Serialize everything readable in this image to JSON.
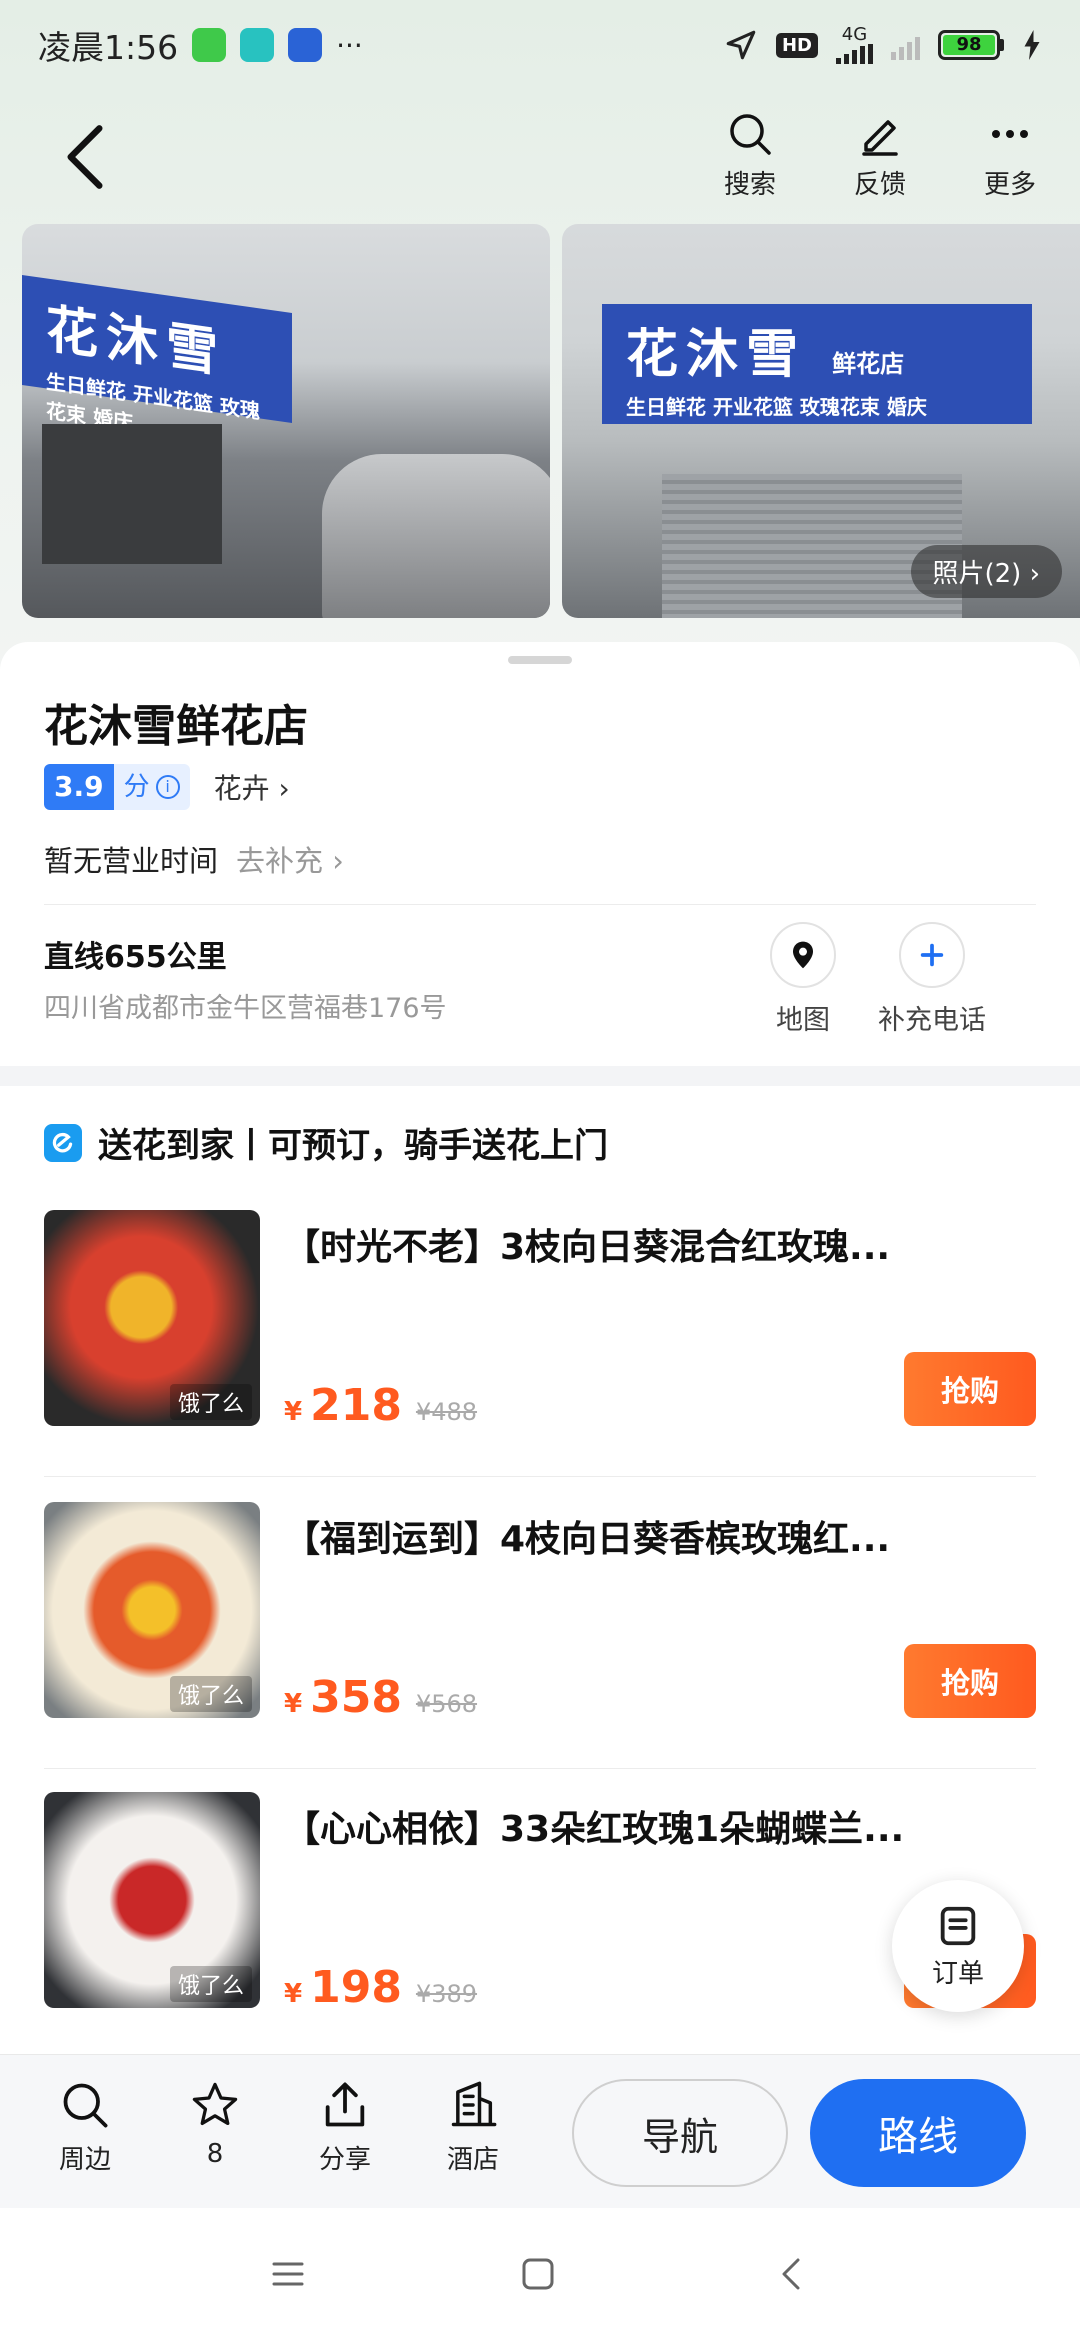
{
  "status_bar": {
    "time": "凌晨1:56",
    "more": "···",
    "hd": "HD",
    "network": "4G",
    "battery": "98"
  },
  "header": {
    "actions": [
      {
        "label": "搜索",
        "icon": "search-icon"
      },
      {
        "label": "反馈",
        "icon": "pencil-icon"
      },
      {
        "label": "更多",
        "icon": "more-icon"
      }
    ]
  },
  "photos": {
    "sign_text": "花沐雪",
    "sign_sub": "鲜花店",
    "sign_tagline_1": "生日鲜花 开业花篮 玫瑰花束 婚庆",
    "count_label": "照片(2) ›"
  },
  "poi": {
    "name": "花沐雪鲜花店",
    "rating": "3.9",
    "rating_unit": "分",
    "category": "花卉 ›",
    "hours": "暂无营业时间",
    "hours_link": "去补充 ›",
    "distance": "直线655公里",
    "address": "四川省成都市金牛区营福巷176号",
    "map_label": "地图",
    "phone_label": "补充电话"
  },
  "promo": {
    "title": "送花到家丨可预订，骑手送花上门",
    "currency": "¥",
    "thumb_tag": "饿了么",
    "buy_label": "抢购",
    "products": [
      {
        "name": "【时光不老】3枝向日葵混合红玫瑰...",
        "price": "218",
        "original": "¥488"
      },
      {
        "name": "【福到运到】4枝向日葵香槟玫瑰红...",
        "price": "358",
        "original": "¥568"
      },
      {
        "name": "【心心相依】33朵红玫瑰1朵蝴蝶兰...",
        "price": "198",
        "original": "¥389"
      }
    ]
  },
  "float_order": {
    "label": "订单"
  },
  "action_bar": {
    "items": [
      {
        "label": "周边",
        "icon": "search-icon"
      },
      {
        "label": "8",
        "icon": "star-icon"
      },
      {
        "label": "分享",
        "icon": "share-icon"
      },
      {
        "label": "酒店",
        "icon": "hotel-icon"
      }
    ],
    "navigate": "导航",
    "route": "路线"
  },
  "colors": {
    "accent_blue": "#1f6ff2",
    "price_orange": "#ff5a1f",
    "rating_blue": "#2f7bf6"
  }
}
